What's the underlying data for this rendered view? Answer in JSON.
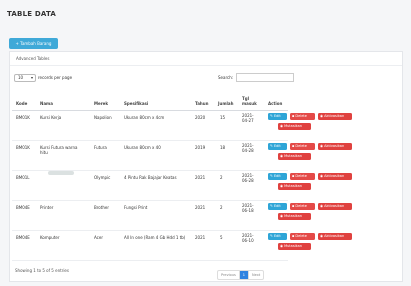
{
  "page": {
    "title": "TABLE DATA"
  },
  "toolbar": {
    "add_label": "Tambah Barang"
  },
  "panel": {
    "heading": "Advanced Tables"
  },
  "controls": {
    "page_length": "10",
    "page_length_suffix": "records per page",
    "search_label": "Search:",
    "search_value": ""
  },
  "table": {
    "headers": {
      "kode": "Kode",
      "nama": "Nama",
      "merek": "Merek",
      "spesifikasi": "Spesifikasi",
      "tahun": "Tahun",
      "jumlah": "Jumlah",
      "tgl_masuk_1": "Tgl",
      "tgl_masuk_2": "masuk",
      "action": "Action"
    },
    "rows": [
      {
        "kode": "BM01K",
        "nama": "Kursi Kerja",
        "merek": "Napolion",
        "spesifikasi": "Ukuran 80cm x 4cm",
        "tahun": "2020",
        "jumlah": "15",
        "tgl_1": "2021-",
        "tgl_2": "04-27"
      },
      {
        "kode": "BM01K",
        "nama": "Kursi Futura warna hitu",
        "merek": "Futura",
        "spesifikasi": "Ukuran 80cm x 40",
        "tahun": "2019",
        "jumlah": "18",
        "tgl_1": "2021-",
        "tgl_2": "04-28"
      },
      {
        "kode": "BM01L",
        "nama": "",
        "merek": "Olympic",
        "spesifikasi": "4 Pintu Rak Bajajar Keatas",
        "tahun": "2021",
        "jumlah": "2",
        "tgl_1": "2021-",
        "tgl_2": "06-28"
      },
      {
        "kode": "BM04E",
        "nama": "Printer",
        "merek": "Brother",
        "spesifikasi": "Fungsi Print",
        "tahun": "2021",
        "jumlah": "2",
        "tgl_1": "2021-",
        "tgl_2": "06-18"
      },
      {
        "kode": "BM04E",
        "nama": "Komputer",
        "merek": "Acer",
        "spesifikasi": "All In one (Ram 4 Gb Hdd 1 tb)",
        "tahun": "2021",
        "jumlah": "5",
        "tgl_1": "2021-",
        "tgl_2": "06-10"
      }
    ],
    "actions": {
      "edit": "Edit",
      "delete": "Delete",
      "aktivasi": "Aktivasikan",
      "mutasi": "Mutasikan"
    }
  },
  "footer": {
    "info": "Showing 1 to 5 of 5 entries",
    "prev": "Previous",
    "page": "1",
    "next": "Next"
  },
  "colors": {
    "primary": "#3fa9d8",
    "edit": "#2ea5d7",
    "danger": "#e44a48",
    "page_active": "#2f83e0"
  }
}
